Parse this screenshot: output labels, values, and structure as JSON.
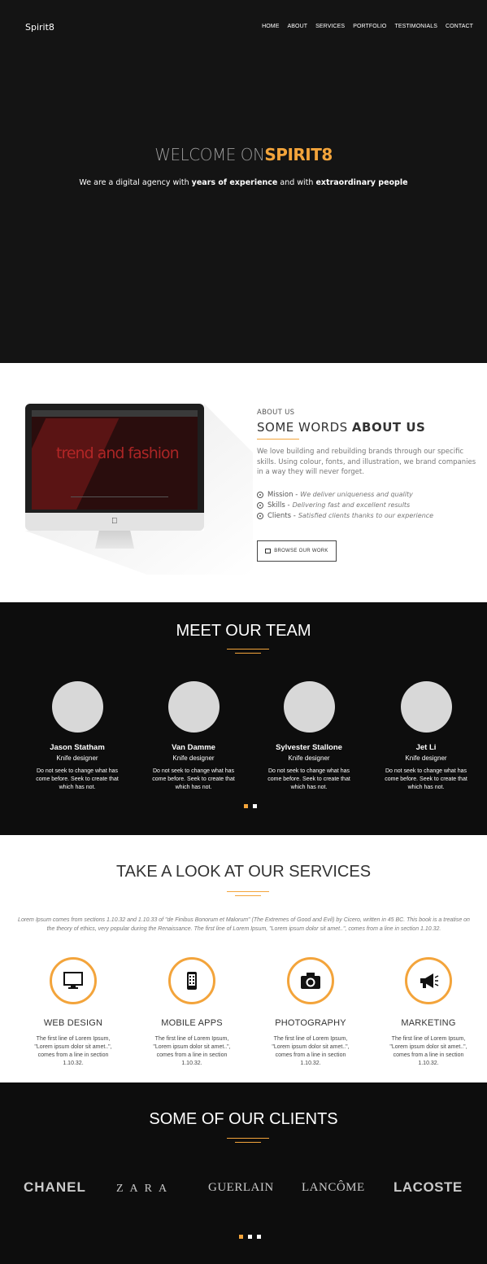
{
  "brand": "Spirit8",
  "nav": [
    "HOME",
    "ABOUT",
    "SERVICES",
    "PORTFOLIO",
    "TESTIMONIALS",
    "CONTACT"
  ],
  "hero": {
    "title_prefix": "WELCOME ON",
    "title_accent": "SPIRIT8",
    "sub_1": "We are a digital agency with ",
    "sub_b1": "years of experience",
    "sub_2": " and with ",
    "sub_b2": "extraordinary people"
  },
  "about": {
    "kicker": "ABOUT US",
    "title_light": "SOME  WORDS ",
    "title_bold": "ABOUT US",
    "paragraph": "We love building and rebuilding brands through our specific skills. Using colour, fonts, and illustration, we brand companies in a way they will never forget.",
    "items": [
      {
        "label": "Mission -",
        "desc": "We deliver uniqueness and quality"
      },
      {
        "label": "Skills -",
        "desc": "Delivering fast and excellent results"
      },
      {
        "label": "Clients -",
        "desc": "Satisfied clients thanks to our experience"
      }
    ],
    "button": "BROWSE OUR WORK",
    "screen_title": "trend and fashion"
  },
  "team": {
    "title_light": "MEET ",
    "title_bold": "OUR TEAM",
    "members": [
      {
        "name": "Jason Statham",
        "role": "Knife designer",
        "desc": "Do not seek to change what has come before. Seek to create that which has not."
      },
      {
        "name": "Van Damme",
        "role": "Knife designer",
        "desc": "Do not seek to change what has come before. Seek to create that which has not."
      },
      {
        "name": "Sylvester Stallone",
        "role": "Knife designer",
        "desc": "Do not seek to change what has come before. Seek to create that which has not."
      },
      {
        "name": "Jet Li",
        "role": "Knife designer",
        "desc": "Do not seek to change what has come before. Seek to create that which has not."
      }
    ]
  },
  "services": {
    "title_light": "TAKE A LOOK AT ",
    "title_bold": "OUR SERVICES",
    "intro": "Lorem Ipsum comes from sections 1.10.32 and 1.10.33 of \"de Finibus Bonorum et Malorum\" (The Extremes of Good and Evil) by Cicero, written in 45 BC. This book is a treatise on the theory of ethics, very popular during the Renaissance. The first line of Lorem Ipsum, \"Lorem ipsum dolor sit amet..\", comes from a line in section 1.10.32.",
    "items": [
      {
        "title": "WEB DESIGN",
        "icon": "monitor-icon",
        "text": "The first line of Lorem Ipsum, \"Lorem ipsum dolor sit amet..\", comes from a line in section 1.10.32."
      },
      {
        "title": "MOBILE APPS",
        "icon": "mobile-icon",
        "text": "The first line of Lorem Ipsum, \"Lorem ipsum dolor sit amet..\", comes from a line in section 1.10.32."
      },
      {
        "title": "PHOTOGRAPHY",
        "icon": "camera-icon",
        "text": "The first line of Lorem Ipsum, \"Lorem ipsum dolor sit amet..\", comes from a line in section 1.10.32."
      },
      {
        "title": "MARKETING",
        "icon": "megaphone-icon",
        "text": "The first line of Lorem Ipsum, \"Lorem ipsum dolor sit amet..\", comes from a line in section 1.10.32."
      }
    ]
  },
  "clients": {
    "title_light": "SOME OF ",
    "title_bold": "OUR CLIENTS",
    "logos": [
      "CHANEL",
      "ZARA",
      "GUERLAIN",
      "LANCÔME",
      "LACOSTE"
    ]
  },
  "colors": {
    "accent": "#f3a43b",
    "dark": "#0d0d0d",
    "hero_bg": "#141414"
  }
}
